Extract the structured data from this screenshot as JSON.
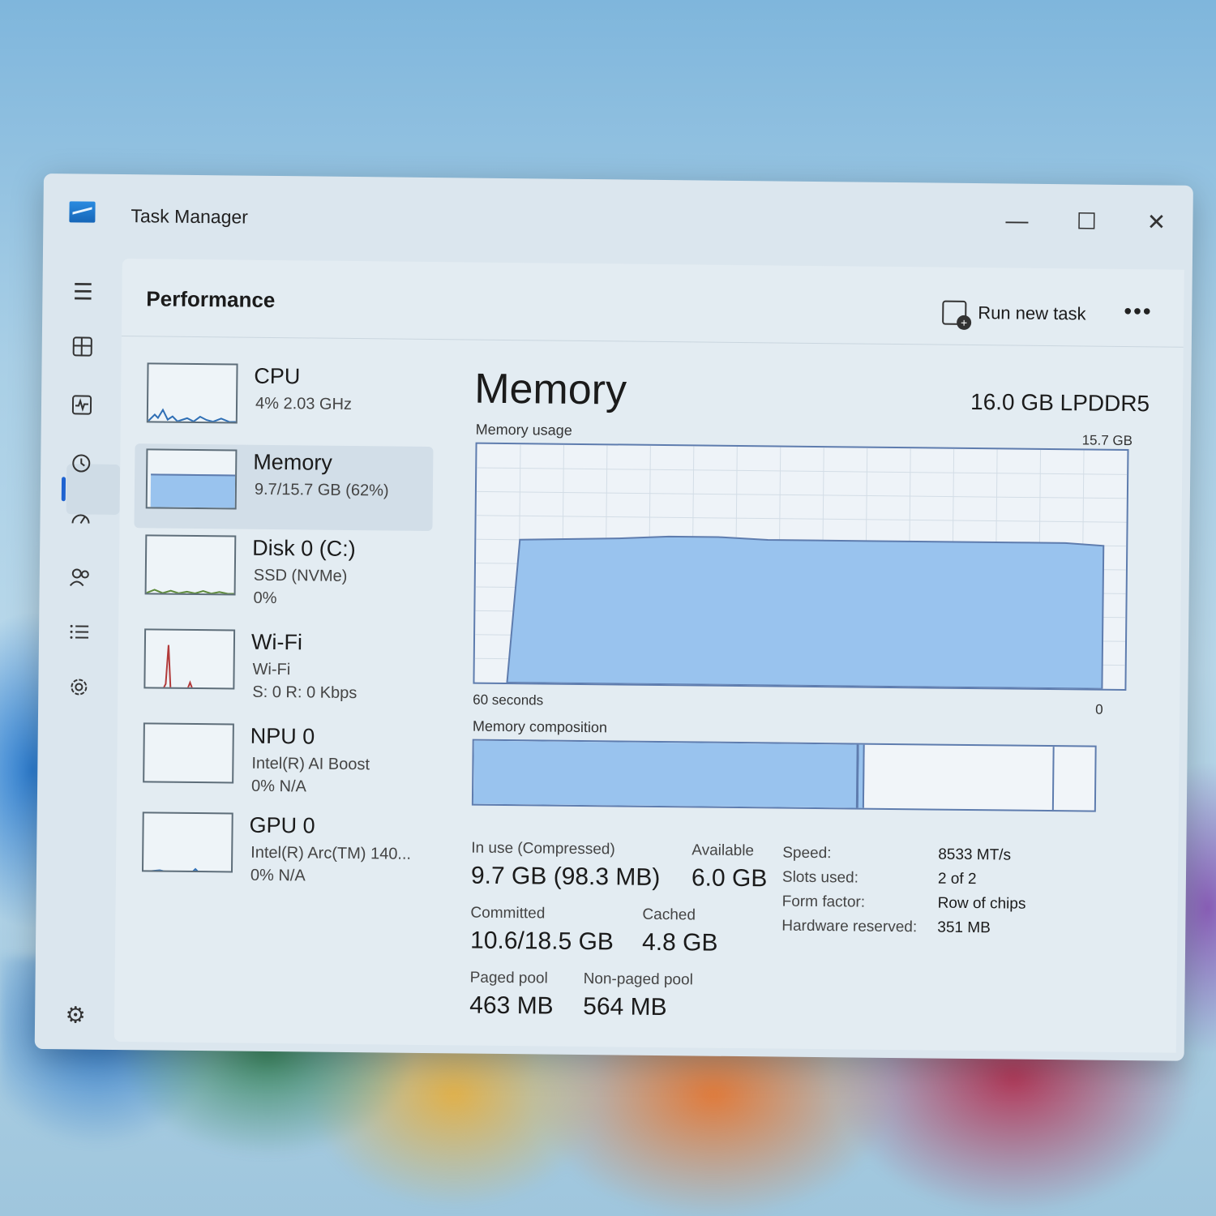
{
  "window": {
    "title": "Task Manager",
    "controls": {
      "minimize": "—",
      "maximize": "☐",
      "close": "✕"
    }
  },
  "rail": {
    "icons": [
      "hamburger-icon",
      "processes-icon",
      "performance-icon",
      "app-history-icon",
      "startup-apps-icon",
      "users-icon",
      "details-icon",
      "services-icon",
      "settings-icon"
    ],
    "active": "performance-icon"
  },
  "header": {
    "title": "Performance",
    "run_new_task": "Run new task",
    "more": "•••"
  },
  "devices": [
    {
      "name": "CPU",
      "sub1": "4% 2.03 GHz",
      "sub2": ""
    },
    {
      "name": "Memory",
      "sub1": "9.7/15.7 GB (62%)",
      "sub2": ""
    },
    {
      "name": "Disk 0 (C:)",
      "sub1": "SSD (NVMe)",
      "sub2": "0%"
    },
    {
      "name": "Wi-Fi",
      "sub1": "Wi-Fi",
      "sub2": "S: 0 R: 0 Kbps"
    },
    {
      "name": "NPU 0",
      "sub1": "Intel(R) AI Boost",
      "sub2": "0% N/A"
    },
    {
      "name": "GPU 0",
      "sub1": "Intel(R) Arc(TM) 140...",
      "sub2": "0% N/A"
    }
  ],
  "memory": {
    "title": "Memory",
    "type": "16.0 GB LPDDR5",
    "usage_label": "Memory usage",
    "usage_max": "15.7 GB",
    "axis_left": "60 seconds",
    "axis_right": "0",
    "composition_label": "Memory composition",
    "composition": {
      "in_use_fraction": 0.62,
      "modified_fraction": 0.005,
      "standby_fraction": 0.3
    },
    "usage_series_fraction": [
      0.0,
      0.0,
      0.6,
      0.61,
      0.62,
      0.62,
      0.61,
      0.61,
      0.61,
      0.61,
      0.61,
      0.61,
      0.61,
      0.6
    ],
    "stats": {
      "in_use_label": "In use (Compressed)",
      "in_use_value": "9.7 GB (98.3 MB)",
      "available_label": "Available",
      "available_value": "6.0 GB",
      "committed_label": "Committed",
      "committed_value": "10.6/18.5 GB",
      "cached_label": "Cached",
      "cached_value": "4.8 GB",
      "paged_label": "Paged pool",
      "paged_value": "463 MB",
      "nonpaged_label": "Non-paged pool",
      "nonpaged_value": "564 MB"
    },
    "specs": {
      "speed_label": "Speed:",
      "speed_value": "8533 MT/s",
      "slots_label": "Slots used:",
      "slots_value": "2 of 2",
      "form_label": "Form factor:",
      "form_value": "Row of chips",
      "hw_label": "Hardware reserved:",
      "hw_value": "351 MB"
    }
  },
  "colors": {
    "accent": "#1f63d0",
    "graph_fill": "#99c3ee",
    "graph_border": "#5e7cae"
  }
}
